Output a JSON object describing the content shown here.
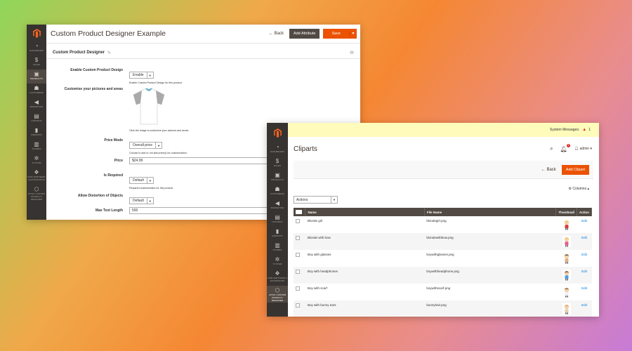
{
  "window1": {
    "nav": [
      {
        "icon": "dashboard-icon",
        "glyph": "◔",
        "label": "DASHBOARD"
      },
      {
        "icon": "sales-icon",
        "glyph": "$",
        "label": "SALES"
      },
      {
        "icon": "products-icon",
        "glyph": "▣",
        "label": "PRODUCTS"
      },
      {
        "icon": "customers-icon",
        "glyph": "☗",
        "label": "CUSTOMERS"
      },
      {
        "icon": "marketing-icon",
        "glyph": "◀",
        "label": "MARKETING"
      },
      {
        "icon": "content-icon",
        "glyph": "▤",
        "label": "CONTENT"
      },
      {
        "icon": "reports-icon",
        "glyph": "▮",
        "label": "REPORTS"
      },
      {
        "icon": "stores-icon",
        "glyph": "▥",
        "label": "STORES"
      },
      {
        "icon": "system-icon",
        "glyph": "✲",
        "label": "SYSTEM"
      },
      {
        "icon": "partners-icon",
        "glyph": "❖",
        "label": "FIND PARTNERS & EXTENSIONS"
      },
      {
        "icon": "designer-icon",
        "glyph": "⬡",
        "label": "AITOC CUSTOM PRODUCT DESIGNER"
      }
    ],
    "title": "Custom Product Designer Example",
    "back_label": "Back",
    "add_attribute_label": "Add Attribute",
    "save_label": "Save",
    "section_title": "Custom Product Designer",
    "fields": {
      "enable": {
        "label": "Enable Custom Product Design",
        "value": "Enable",
        "note": "Enable Custom Product Design for this product"
      },
      "customise": {
        "label": "Customise your pictures and areas",
        "note": "Click the image to customize your pictures and areas"
      },
      "price_mode": {
        "label": "Price Mode",
        "value": "Overall price",
        "note": "Choose to add or not add price(s) for customization."
      },
      "price": {
        "label": "Price",
        "value": "$24.99"
      },
      "is_required": {
        "label": "Is Required",
        "value": "Default",
        "note": "Required customization for this product"
      },
      "distortion": {
        "label": "Allow Distortion of Objects",
        "value": "Default"
      },
      "max_text": {
        "label": "Max Text Length",
        "value": "500"
      }
    }
  },
  "window2": {
    "nav": [
      {
        "icon": "dashboard-icon",
        "glyph": "◔",
        "label": "DASHBOARD"
      },
      {
        "icon": "sales-icon",
        "glyph": "$",
        "label": "SALES"
      },
      {
        "icon": "products-icon",
        "glyph": "▣",
        "label": "PRODUCTS"
      },
      {
        "icon": "customers-icon",
        "glyph": "☗",
        "label": "CUSTOMERS"
      },
      {
        "icon": "marketing-icon",
        "glyph": "◀",
        "label": "MARKETING"
      },
      {
        "icon": "content-icon",
        "glyph": "▤",
        "label": "CONTENT"
      },
      {
        "icon": "reports-icon",
        "glyph": "▮",
        "label": "REPORTS"
      },
      {
        "icon": "stores-icon",
        "glyph": "▥",
        "label": "STORES"
      },
      {
        "icon": "system-icon",
        "glyph": "✲",
        "label": "SYSTEM"
      },
      {
        "icon": "partners-icon",
        "glyph": "❖",
        "label": "FIND PARTNERS & EXTENSIONS"
      },
      {
        "icon": "designer-icon",
        "glyph": "⬡",
        "label": "AITOC CUSTOM PRODUCT DESIGNER"
      }
    ],
    "system_messages": "System Messages:",
    "system_messages_count": "1",
    "title": "Cliparts",
    "notification_count": "3",
    "user": "admin",
    "back_label": "Back",
    "add_label": "Add Clipart",
    "columns_label": "Columns",
    "actions_label": "Actions",
    "headers": [
      "Name",
      "File Name",
      "Thumbnail",
      "Action"
    ],
    "rows": [
      {
        "name": "Blonde girl",
        "file": "blondegirl.png",
        "action": "Edit"
      },
      {
        "name": "Blonde with bow",
        "file": "blondewithbow.png",
        "action": "Edit"
      },
      {
        "name": "Boy with glasses",
        "file": "boywithglasses.png",
        "action": "Edit"
      },
      {
        "name": "Boy with headphones",
        "file": "boywithheadphone.png",
        "action": "Edit"
      },
      {
        "name": "Boy with scarf",
        "file": "boywithscarf.png",
        "action": "Edit"
      },
      {
        "name": "Boy with bunny ears",
        "file": "bunnyhair.png",
        "action": "Edit"
      }
    ]
  },
  "colors": {
    "accent": "#eb5202",
    "dark": "#514943",
    "sidebar": "#373330",
    "link": "#007bdb"
  }
}
